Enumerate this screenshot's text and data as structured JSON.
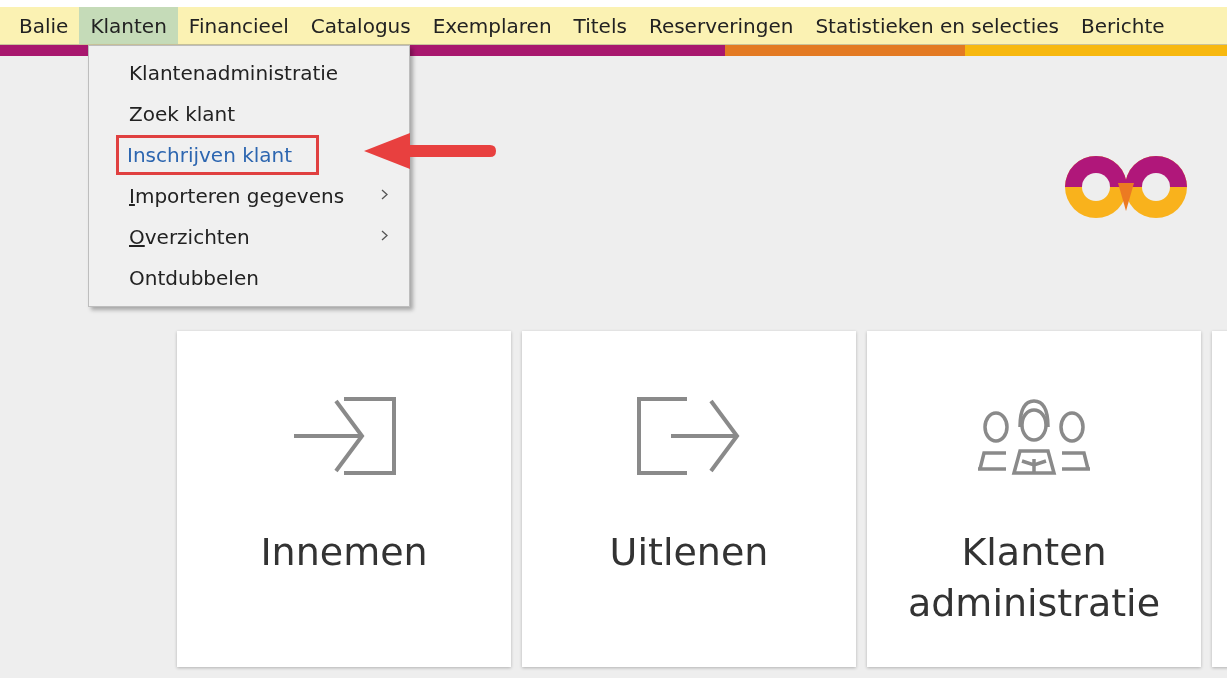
{
  "menubar": [
    {
      "label": "Balie",
      "selected": false
    },
    {
      "label": "Klanten",
      "selected": true
    },
    {
      "label": "Financieel",
      "selected": false
    },
    {
      "label": "Catalogus",
      "selected": false
    },
    {
      "label": "Exemplaren",
      "selected": false
    },
    {
      "label": "Titels",
      "selected": false
    },
    {
      "label": "Reserveringen",
      "selected": false
    },
    {
      "label": "Statistieken en selecties",
      "selected": false
    },
    {
      "label": "Berichte",
      "selected": false
    }
  ],
  "dropdown": [
    {
      "label": "Klantenadministratie",
      "selected": false,
      "submenu": false,
      "mnemonic": false
    },
    {
      "label": "Zoek klant",
      "selected": false,
      "submenu": false,
      "mnemonic": false
    },
    {
      "label": "Inschrijven klant",
      "selected": true,
      "submenu": false,
      "mnemonic": false
    },
    {
      "label": "Importeren gegevens",
      "selected": false,
      "submenu": true,
      "mnemonic": true
    },
    {
      "label": "Overzichten",
      "selected": false,
      "submenu": true,
      "mnemonic": true
    },
    {
      "label": "Ontdubbelen",
      "selected": false,
      "submenu": false,
      "mnemonic": false
    }
  ],
  "tiles": [
    {
      "kind": "checkin",
      "label": "Innemen"
    },
    {
      "kind": "checkout",
      "label": "Uitlenen"
    },
    {
      "kind": "customers",
      "label": "Klanten administratie"
    },
    {
      "kind": "blank"
    }
  ]
}
